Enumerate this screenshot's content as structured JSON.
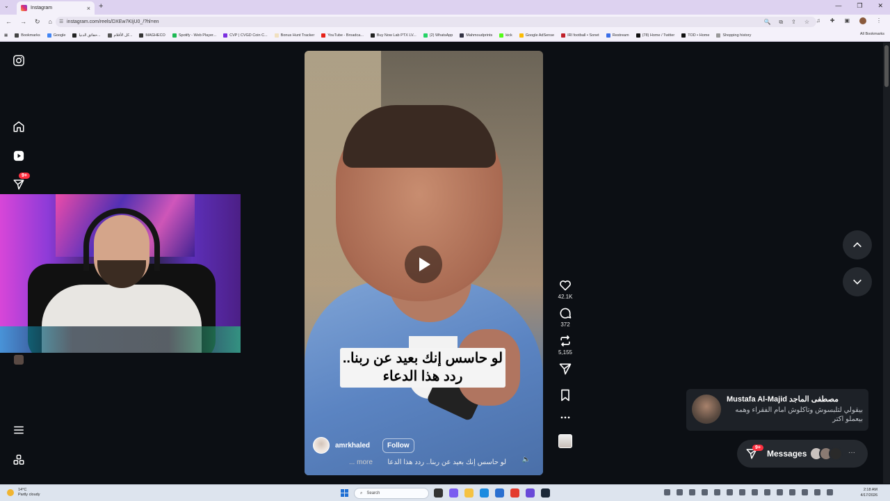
{
  "browser": {
    "tab_title": "Instagram",
    "url": "instagram.com/reels/DXEw7KIjU0_/?hl=en",
    "bookmarks": [
      "Bookmarks",
      "Google",
      "حقائق الدنيا...",
      "كل الأفلام...",
      "MAGHECO",
      "Spotify - Web Player...",
      "CVP | CVGD Coin C...",
      "Bonus Hunt Tracker",
      "YouTube - Broadca...",
      "Buy Now Lab PTX LV...",
      "(2) WhatsApp",
      "Mahmoudprints",
      "kick",
      "Google AdSense",
      "IRI football • Sonet",
      "Restream",
      "(78) Home / Twitter",
      "TOD • Home",
      "Shopping history"
    ],
    "all_bookmarks": "All Bookmarks"
  },
  "sidebar": {
    "notifications_badge": "9+"
  },
  "reel": {
    "caption_line1": "لو حاسس إنك بعيد عن ربنا..",
    "caption_line2": "ردد هذا الدعاء",
    "username": "amrkhaled",
    "follow_label": "Follow",
    "description": "لو حاسس إنك بعيد عن ربنا.. ردد هذا الدعاء",
    "more_label": "... more"
  },
  "actions": {
    "likes": "42.1K",
    "comments": "372",
    "reposts": "5,155"
  },
  "notification": {
    "title": "Mustafa Al-Majid مصطفى الماجد",
    "message": "بيقولي لتلبسوش وتاكلوش امام الفقراء وهمه بيعملو اكتر"
  },
  "messages": {
    "label": "Messages",
    "badge": "9+"
  },
  "taskbar": {
    "temperature": "14°C",
    "weather": "Partly cloudy",
    "search_placeholder": "Search",
    "time": "2:18 AM",
    "date": "4/17/2026"
  }
}
